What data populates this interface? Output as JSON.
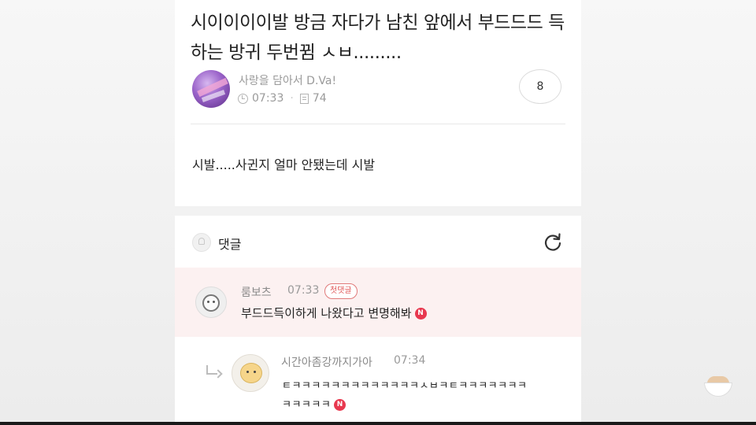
{
  "post": {
    "title": "시이이이이발 방금 자다가 남친 앞에서 부드드드 득하는 방귀 두번뀜 ㅅㅂ.........",
    "author": "사랑을 담아서 D.Va!",
    "time": "07:33",
    "views": "74",
    "comment_count": "8",
    "body": "시발.....사귄지 얼마 안됐는데 시발"
  },
  "comments_section": {
    "label": "댓글",
    "icons": {
      "bell": "bell-icon",
      "refresh": "refresh-icon"
    }
  },
  "comments": [
    {
      "name": "룸보츠",
      "time": "07:33",
      "badge": "첫댓글",
      "text": "부드드득이하게 나왔다고 변명해봐",
      "new_badge": "N"
    },
    {
      "name": "시간아좀강까지가아",
      "time": "07:34",
      "text_line1": "ㅌㅋㅋㅋㅋㅋㅋㅋㅋㅋㅋㅋㅋㅋㅅㅂㅋㅌㅋㅋㅋㅋㅋㅋㅋ",
      "text_line2": "ㅋㅋㅋㅋㅋ",
      "new_badge": "N"
    }
  ],
  "colors": {
    "first_comment_bg": "#fcf1f1",
    "badge_red": "#e05555",
    "new_badge": "#e8384f"
  }
}
